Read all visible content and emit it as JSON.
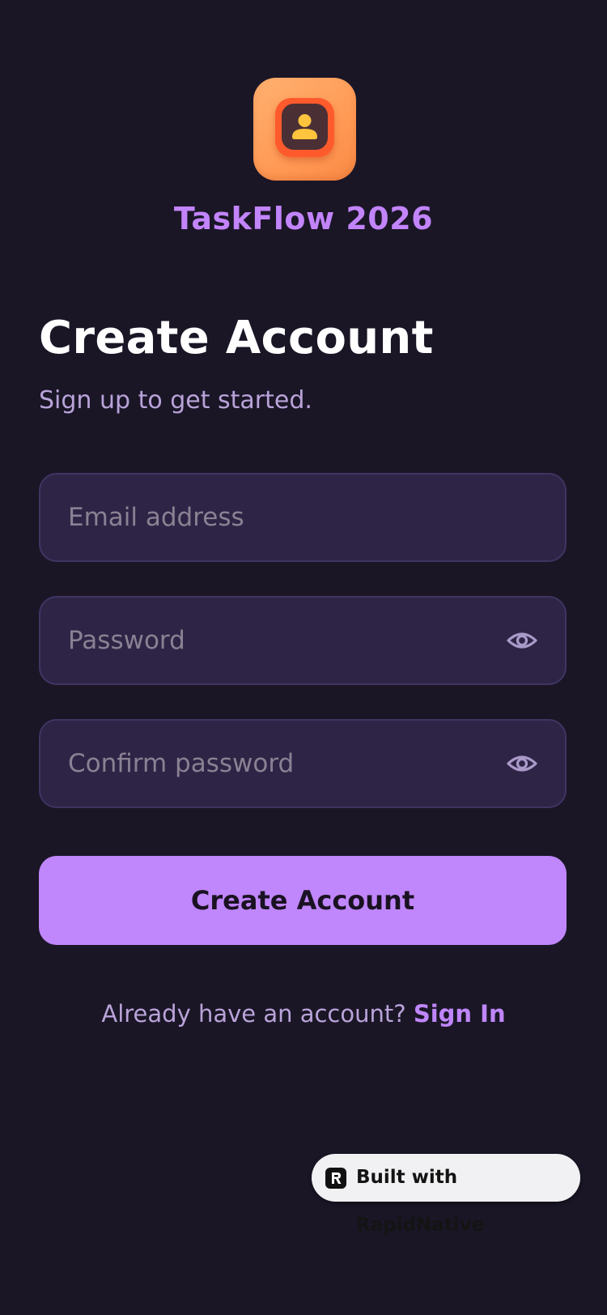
{
  "app": {
    "name": "TaskFlow 2026",
    "logo_icon": "user-icon"
  },
  "header": {
    "title": "Create Account",
    "subtitle": "Sign up to get started."
  },
  "form": {
    "email": {
      "placeholder": "Email address",
      "value": ""
    },
    "password": {
      "placeholder": "Password",
      "value": "",
      "toggle_icon": "eye-icon"
    },
    "confirm_password": {
      "placeholder": "Confirm password",
      "value": "",
      "toggle_icon": "eye-icon"
    },
    "submit_label": "Create Account"
  },
  "footer": {
    "prompt": "Already have an account?",
    "link_label": "Sign In"
  },
  "badge": {
    "label": "Built with RapidNative",
    "icon": "rapidnative-logo-icon"
  },
  "colors": {
    "background": "#1a1626",
    "accent": "#c086fb",
    "field_background": "#2e2446",
    "field_border": "#403462",
    "subtitle_text": "#b9a3d9",
    "logo_orange": "#ff9a55"
  }
}
